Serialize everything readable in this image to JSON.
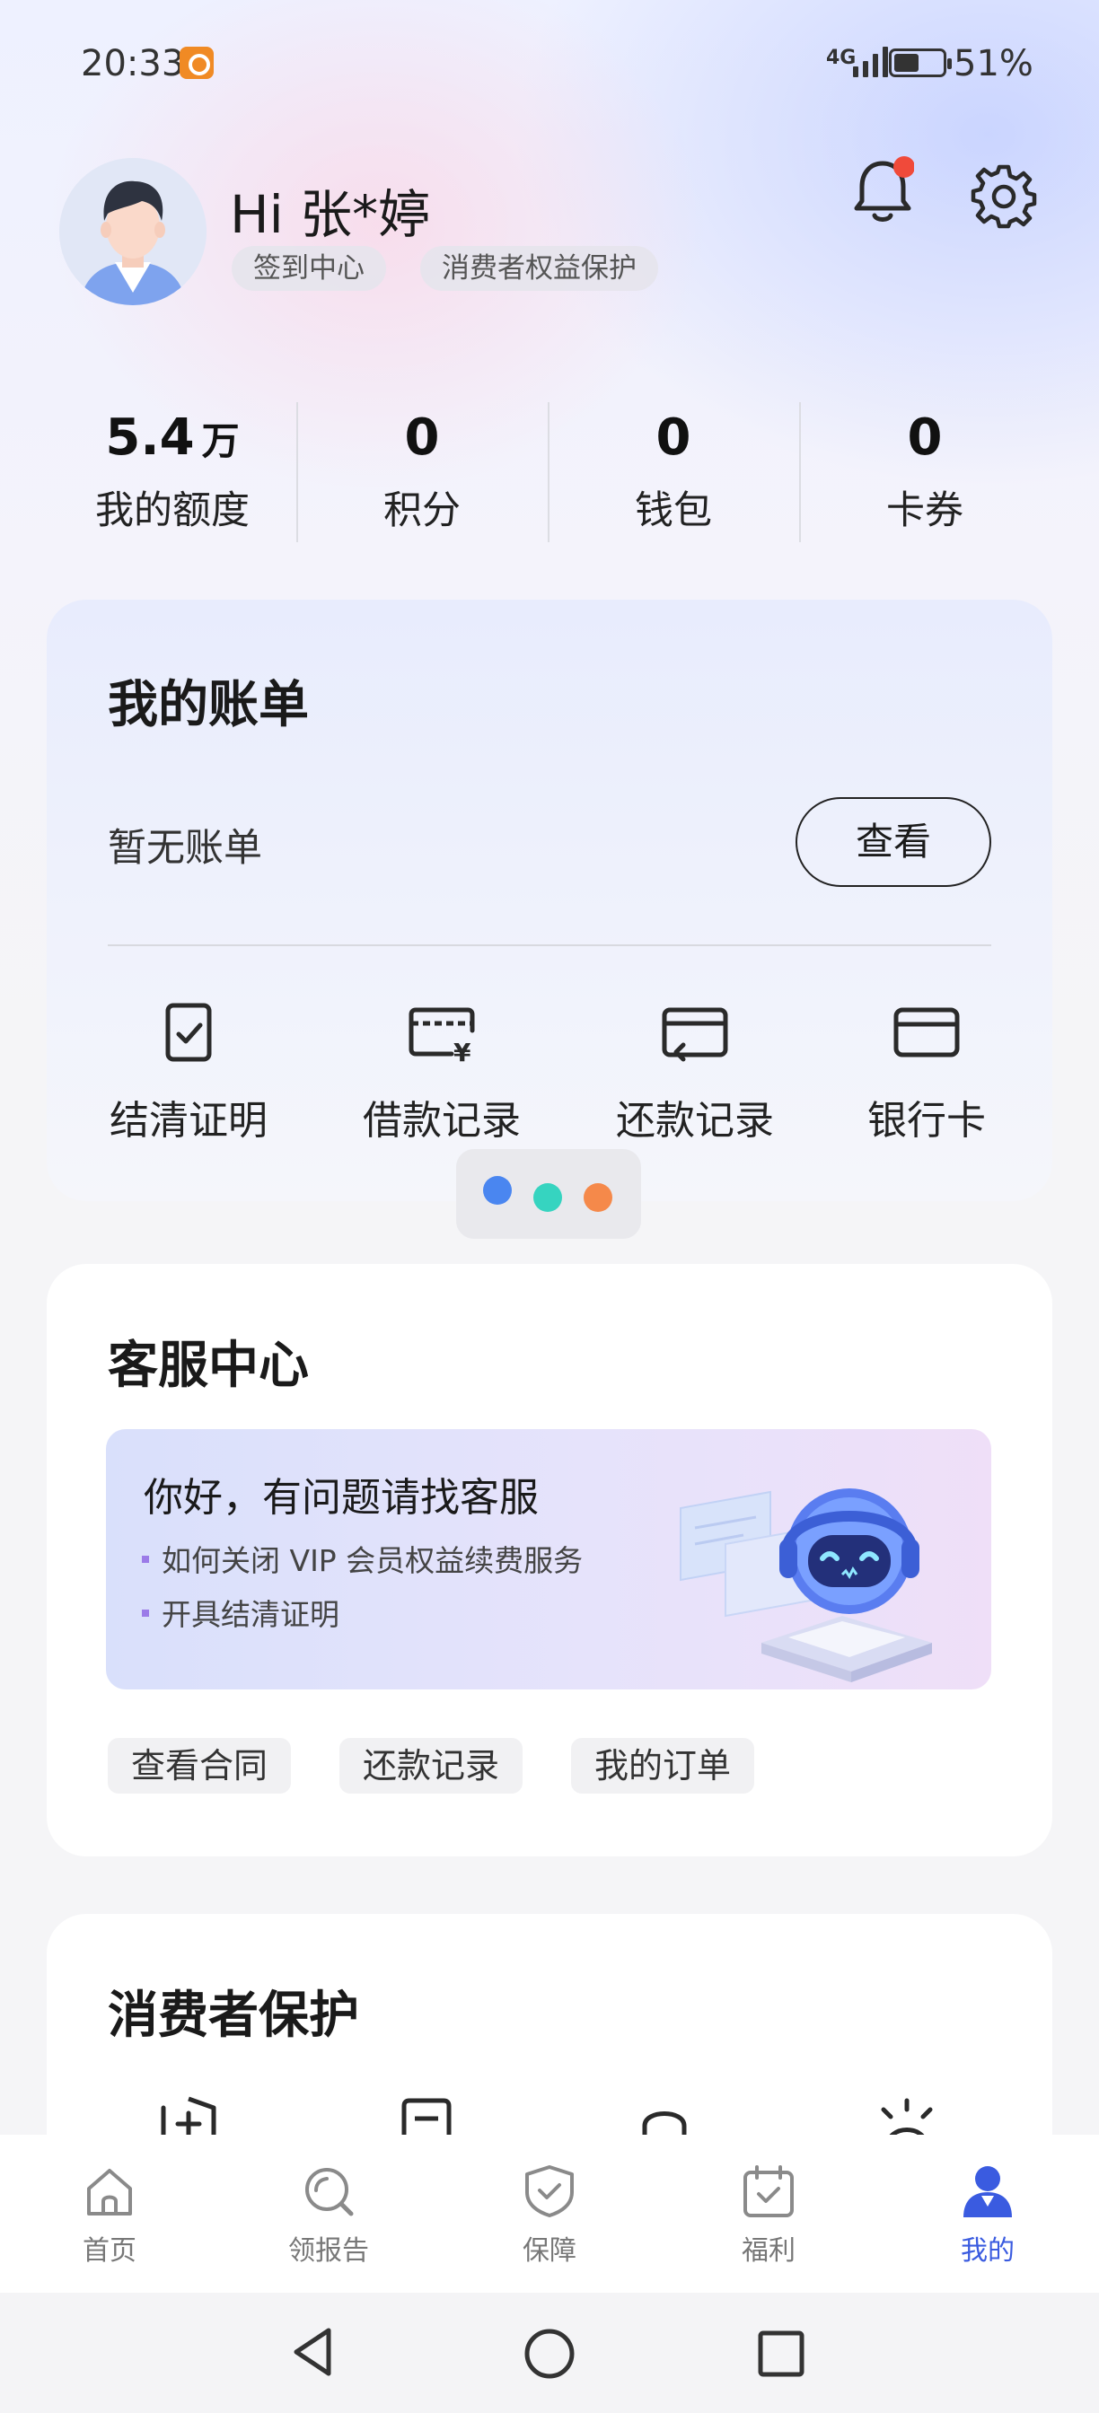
{
  "status_bar": {
    "time": "20:33",
    "network": "4G",
    "battery": "51%",
    "battery_level": 0.51
  },
  "header": {
    "greeting": "Hi 张*婷",
    "chips": [
      "签到中心",
      "消费者权益保护"
    ]
  },
  "stats": [
    {
      "value": "5.4",
      "unit": "万",
      "label": "我的额度"
    },
    {
      "value": "0",
      "unit": "",
      "label": "积分"
    },
    {
      "value": "0",
      "unit": "",
      "label": "钱包"
    },
    {
      "value": "0",
      "unit": "",
      "label": "卡券"
    }
  ],
  "bill": {
    "title": "我的账单",
    "empty_text": "暂无账单",
    "view_label": "查看",
    "actions": [
      {
        "label": "结清证明",
        "icon": "settlement-certificate-icon"
      },
      {
        "label": "借款记录",
        "icon": "loan-record-icon"
      },
      {
        "label": "还款记录",
        "icon": "repayment-record-icon"
      },
      {
        "label": "银行卡",
        "icon": "bank-card-icon"
      }
    ],
    "pager_colors": [
      "#4a86f0",
      "#36d4c0",
      "#f5894a"
    ]
  },
  "service": {
    "title": "客服中心",
    "banner_title": "你好，有问题请找客服",
    "faqs": [
      "如何关闭 VIP 会员权益续费服务",
      "开具结清证明"
    ],
    "tags": [
      "查看合同",
      "还款记录",
      "我的订单"
    ]
  },
  "protection": {
    "title": "消费者保护"
  },
  "bottom_nav": [
    {
      "label": "首页",
      "icon": "home-icon"
    },
    {
      "label": "领报告",
      "icon": "report-search-icon"
    },
    {
      "label": "保障",
      "icon": "shield-check-icon"
    },
    {
      "label": "福利",
      "icon": "calendar-check-icon"
    },
    {
      "label": "我的",
      "icon": "person-icon",
      "active": true
    }
  ],
  "colors": {
    "accent": "#3a5be0",
    "notification_dot": "#f04a3a"
  }
}
